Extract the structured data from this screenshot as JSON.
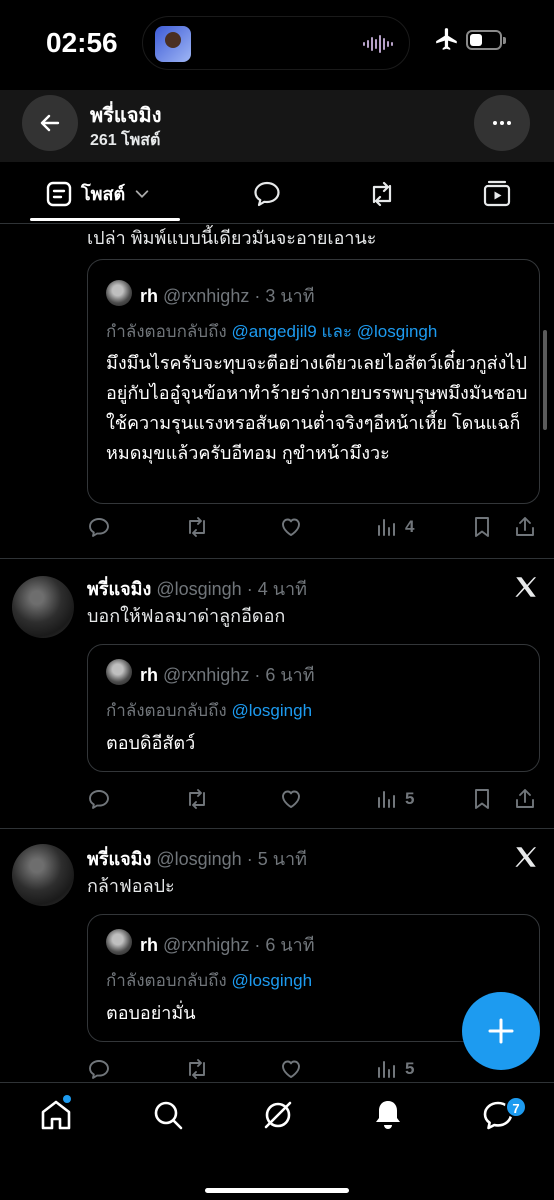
{
  "status_bar": {
    "time": "02:56"
  },
  "header": {
    "title": "พรี่แจมิง",
    "subtitle": "261 โพสต์"
  },
  "tabs": [
    {
      "label": "โพสต์",
      "icon": "posts-icon",
      "active": true
    },
    {
      "icon": "replies-icon"
    },
    {
      "icon": "reposts-icon"
    },
    {
      "icon": "media-icon"
    }
  ],
  "posts": [
    {
      "text": "เปล่า พิมพ์แบบนี้เดียวมันจะอายเอานะ",
      "quote": {
        "name": "rh",
        "handle": "@rxnhighz",
        "time": "· 3 นาที",
        "reply_prefix": "กำลังตอบกลับถึง",
        "reply_to": "@angedjil9",
        "reply_and": "และ",
        "reply_to_2": "@losgingh",
        "text": "มึงมึนไรครับจะทุบจะตีอย่างเดียวเลยไอสัตว์เดี๋ยวกูส่งไปอยู่กับไออู๋จุนข้อหาทำร้ายร่างกายบรรพบุรุษพมึงมันชอบใช้ความรุนแรงหรอสันดานต่ำจริงๆอีหน้าเหี้ย โดนแฉก็หมดมุขแล้วครับอีทอม กูขำหน้ามึงวะ"
      },
      "views": "4"
    },
    {
      "name": "พรี่แจมิง",
      "handle": "@losgingh",
      "time": "· 4 นาที",
      "text": "บอกให้ฟอลมาด่าลูกอีดอก",
      "quote": {
        "name": "rh",
        "handle": "@rxnhighz",
        "time": "· 6 นาที",
        "reply_prefix": "กำลังตอบกลับถึง",
        "reply_to": "@losgingh",
        "text": "ตอบดิอีสัตว์"
      },
      "views": "5"
    },
    {
      "name": "พรี่แจมิง",
      "handle": "@losgingh",
      "time": "· 5 นาที",
      "text": "กล้าฟอลปะ",
      "quote": {
        "name": "rh",
        "handle": "@rxnhighz",
        "time": "· 6 นาที",
        "reply_prefix": "กำลังตอบกลับถึง",
        "reply_to": "@losgingh",
        "text": "ตอบอย่ามั่น"
      },
      "views": "5"
    }
  ],
  "bottom_nav": {
    "items": [
      "home-icon",
      "search-icon",
      "grok-icon",
      "notifications-icon",
      "messages-icon"
    ],
    "messages_badge": "7"
  },
  "colors": {
    "accent": "#1d9bf0",
    "background": "#000000",
    "muted": "#71767b"
  }
}
